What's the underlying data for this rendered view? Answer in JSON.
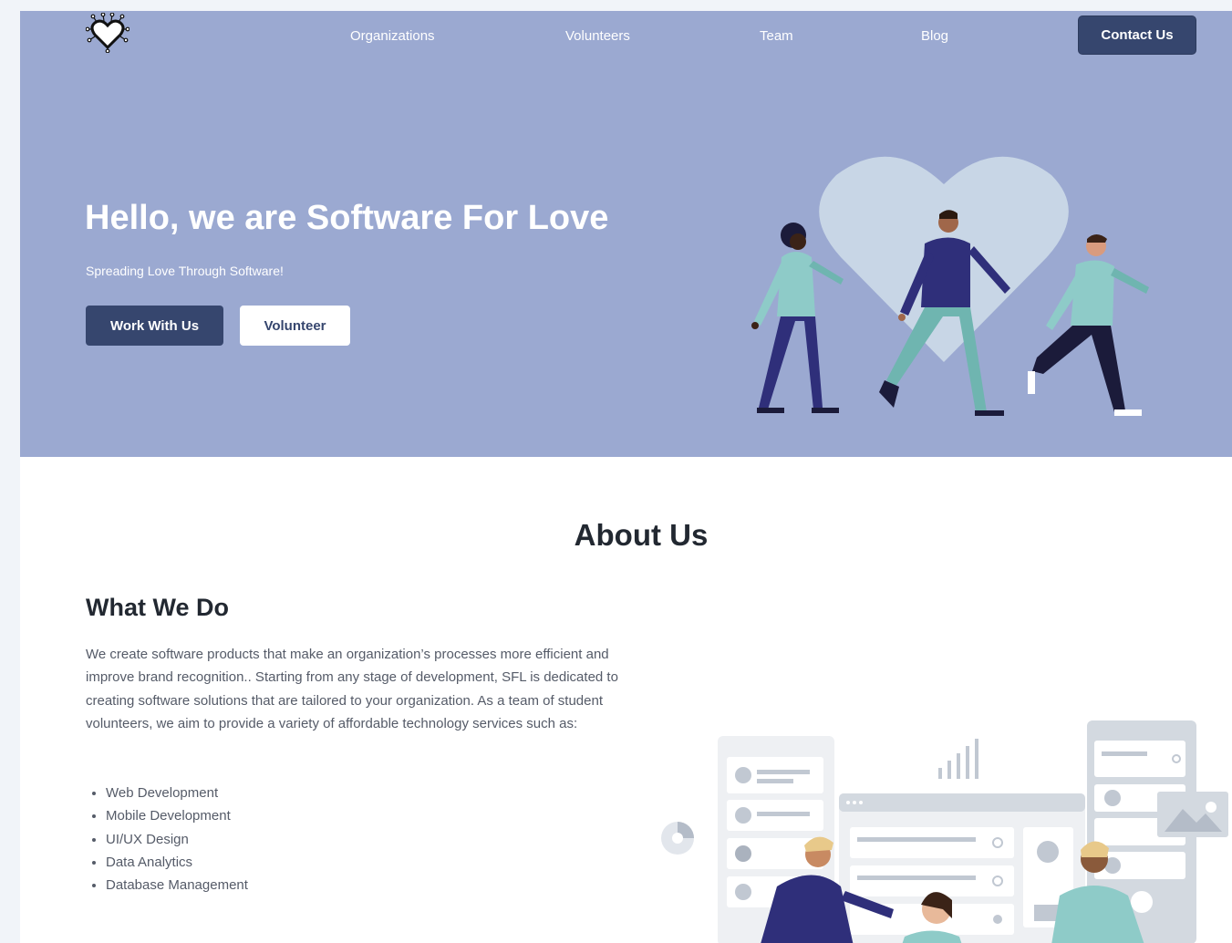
{
  "nav": {
    "logo": "heart-circuit-icon",
    "links": [
      "Organizations",
      "Volunteers",
      "Team",
      "Blog"
    ],
    "contact_label": "Contact Us"
  },
  "hero": {
    "title": "Hello, we are Software For Love",
    "subtitle": "Spreading Love Through Software!",
    "primary_button": "Work With Us",
    "secondary_button": "Volunteer",
    "background_color": "#9ba9d1",
    "button_color": "#36466e"
  },
  "about": {
    "title": "About Us",
    "heading": "What We Do",
    "body": "We create software products that make an organization’s processes more efficient and improve brand recognition.. Starting from any stage of development, SFL is dedicated to creating software solutions that are tailored to your organization. As a team of student volunteers, we aim to provide a variety of affordable technology services such as:",
    "services": [
      "Web Development",
      "Mobile Development",
      "UI/UX Design",
      "Data Analytics",
      "Database Management"
    ]
  }
}
